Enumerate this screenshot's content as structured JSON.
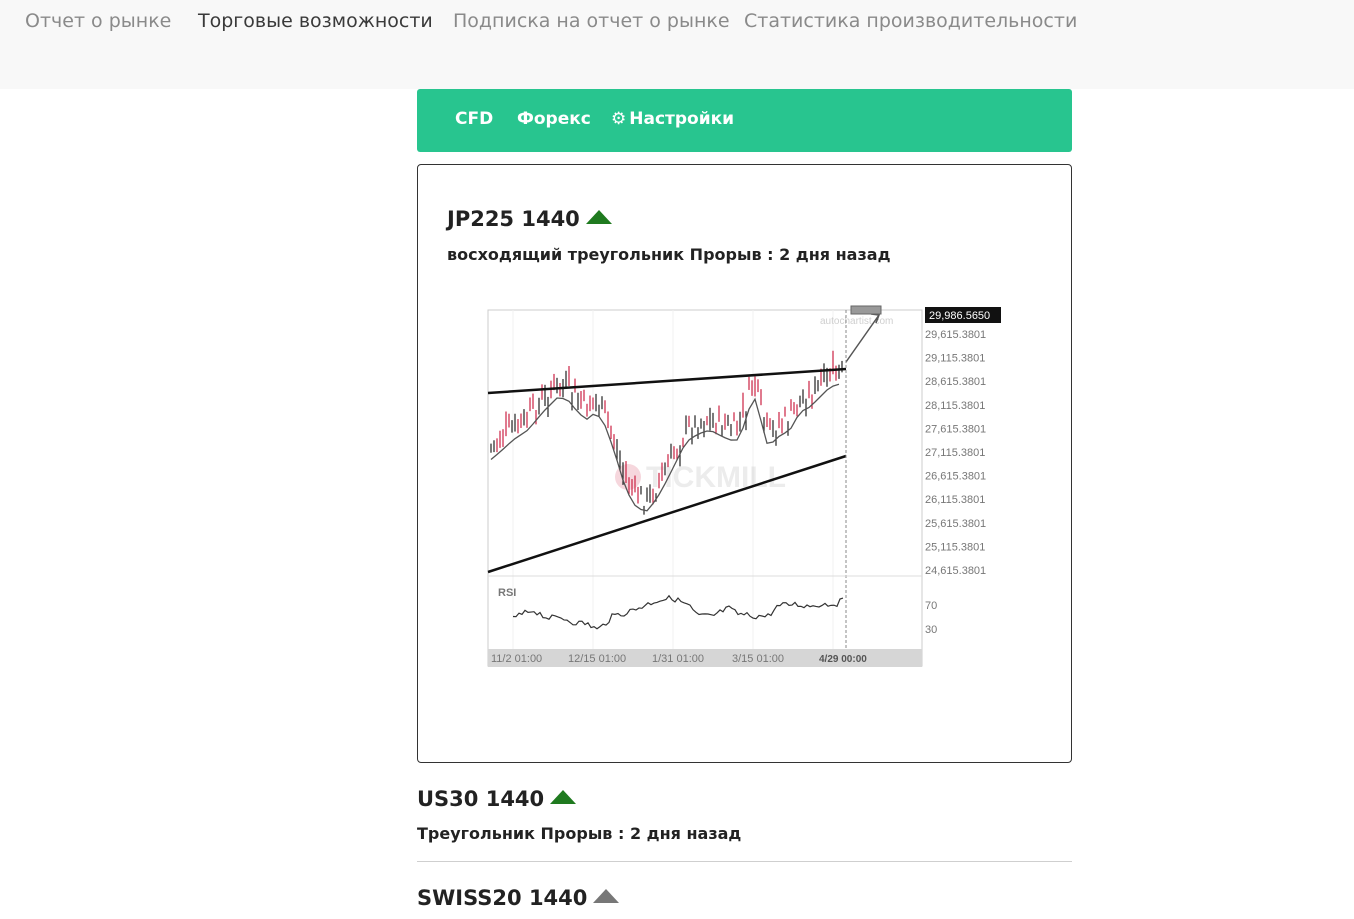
{
  "nav": {
    "items": [
      {
        "label": "Отчет о рынке",
        "active": false
      },
      {
        "label": "Торговые возможности",
        "active": true
      },
      {
        "label": "Подписка на отчет о рынке",
        "active": false
      },
      {
        "label": "Статистика производительности",
        "active": false
      }
    ]
  },
  "tabs": {
    "cfd": "CFD",
    "forex": "Форекс",
    "settings": "Настройки",
    "settings_icon": "gear-icon",
    "bar_color": "#28c58f"
  },
  "signals": [
    {
      "symbol": "JP225 1440",
      "direction": "up",
      "pattern": "восходящий треугольник Прорыв : 2 дня назад"
    },
    {
      "symbol": "US30 1440",
      "direction": "up",
      "pattern": "Треугольник Прорыв : 2 дня назад"
    },
    {
      "symbol": "SWISS20 1440",
      "direction": "neutral"
    }
  ],
  "chart": {
    "price_labels": [
      "29,615.3801",
      "29,115.3801",
      "28,615.3801",
      "28,115.3801",
      "27,615.3801",
      "27,115.3801",
      "26,615.3801",
      "26,115.3801",
      "25,615.3801",
      "25,115.3801",
      "24,615.3801"
    ],
    "current_price": "29,986.5650",
    "rsi_label": "RSI",
    "rsi_levels": [
      "70",
      "30"
    ],
    "date_labels": [
      "11/2 01:00",
      "12/15 01:00",
      "1/31 01:00",
      "3/15 01:00",
      "4/29 00:00"
    ],
    "watermark": "TICKMILL",
    "source_watermark": "autochartist.com",
    "up_color": "#1f7a1f",
    "bear_candle_color": "#cc2244"
  }
}
